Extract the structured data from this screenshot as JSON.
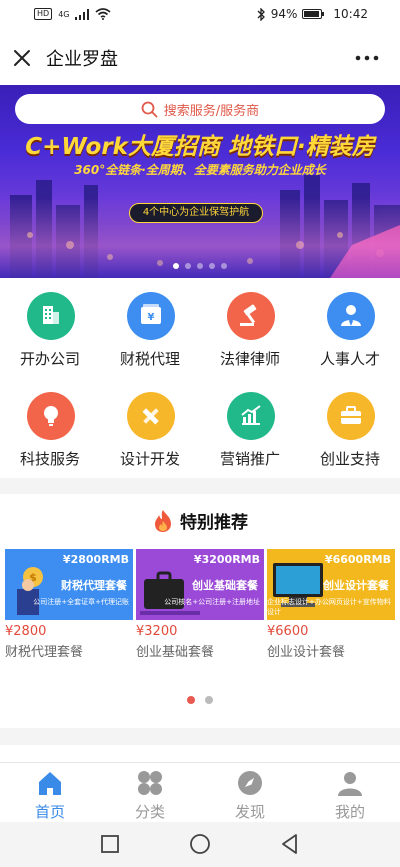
{
  "status_bar": {
    "left_badge": "HD",
    "network": "4G",
    "battery": "94%",
    "battery_level": 0.94,
    "time": "10:42"
  },
  "titlebar": {
    "title": "企业罗盘",
    "close_icon": "close-icon",
    "more_icon": "more-icon"
  },
  "banner": {
    "search_placeholder": "搜索服务/服务商",
    "headline": "C+Work大厦招商 地铁口·精装房",
    "subline": "360°全链条·全周期、全要素服务助力企业成长",
    "badge": "4个中心为企业保驾护航",
    "slide_count": 5,
    "active_slide": 0
  },
  "services": [
    {
      "label": "开办公司",
      "icon": "building-icon",
      "color": "#22b98a"
    },
    {
      "label": "财税代理",
      "icon": "yuan-ledger-icon",
      "color": "#3d8ef0"
    },
    {
      "label": "法律律师",
      "icon": "gavel-icon",
      "color": "#f2654a"
    },
    {
      "label": "人事人才",
      "icon": "person-icon",
      "color": "#3d8ef0"
    },
    {
      "label": "科技服务",
      "icon": "lightbulb-icon",
      "color": "#f2654a"
    },
    {
      "label": "设计开发",
      "icon": "pencil-ruler-icon",
      "color": "#f6b72a"
    },
    {
      "label": "营销推广",
      "icon": "chart-icon",
      "color": "#22b98a"
    },
    {
      "label": "创业支持",
      "icon": "toolbox-icon",
      "color": "#f6b72a"
    }
  ],
  "recommend": {
    "title": "特别推荐",
    "title_icon": "flame-icon",
    "items": [
      {
        "price_tag": "¥2800RMB",
        "package": "财税代理套餐",
        "sub": "公司注册+全套证章+代理记账",
        "price": "¥2800",
        "name": "财税代理套餐",
        "color": "#3d8ef0"
      },
      {
        "price_tag": "¥3200RMB",
        "package": "创业基础套餐",
        "sub": "公司核名+公司注册+注册地址",
        "price": "¥3200",
        "name": "创业基础套餐",
        "color": "#9b4ad8"
      },
      {
        "price_tag": "¥6600RMB",
        "package": "创业设计套餐",
        "sub": "企业标志设计+办公网页设计+宣传物料设计",
        "price": "¥6600",
        "name": "创业设计套餐",
        "color": "#f2b81e"
      }
    ],
    "page_count": 2,
    "active_page": 0
  },
  "tabbar": {
    "tabs": [
      {
        "label": "首页",
        "icon": "home-icon",
        "active": true
      },
      {
        "label": "分类",
        "icon": "category-icon",
        "active": false
      },
      {
        "label": "发现",
        "icon": "compass-icon",
        "active": false
      },
      {
        "label": "我的",
        "icon": "user-icon",
        "active": false
      }
    ]
  },
  "system_nav": {
    "buttons": [
      "recent-apps-icon",
      "home-circle-icon",
      "back-triangle-icon"
    ]
  },
  "colors": {
    "accent_red": "#e24a3b",
    "accent_blue": "#3a8be8",
    "tab_inactive": "#999999"
  }
}
